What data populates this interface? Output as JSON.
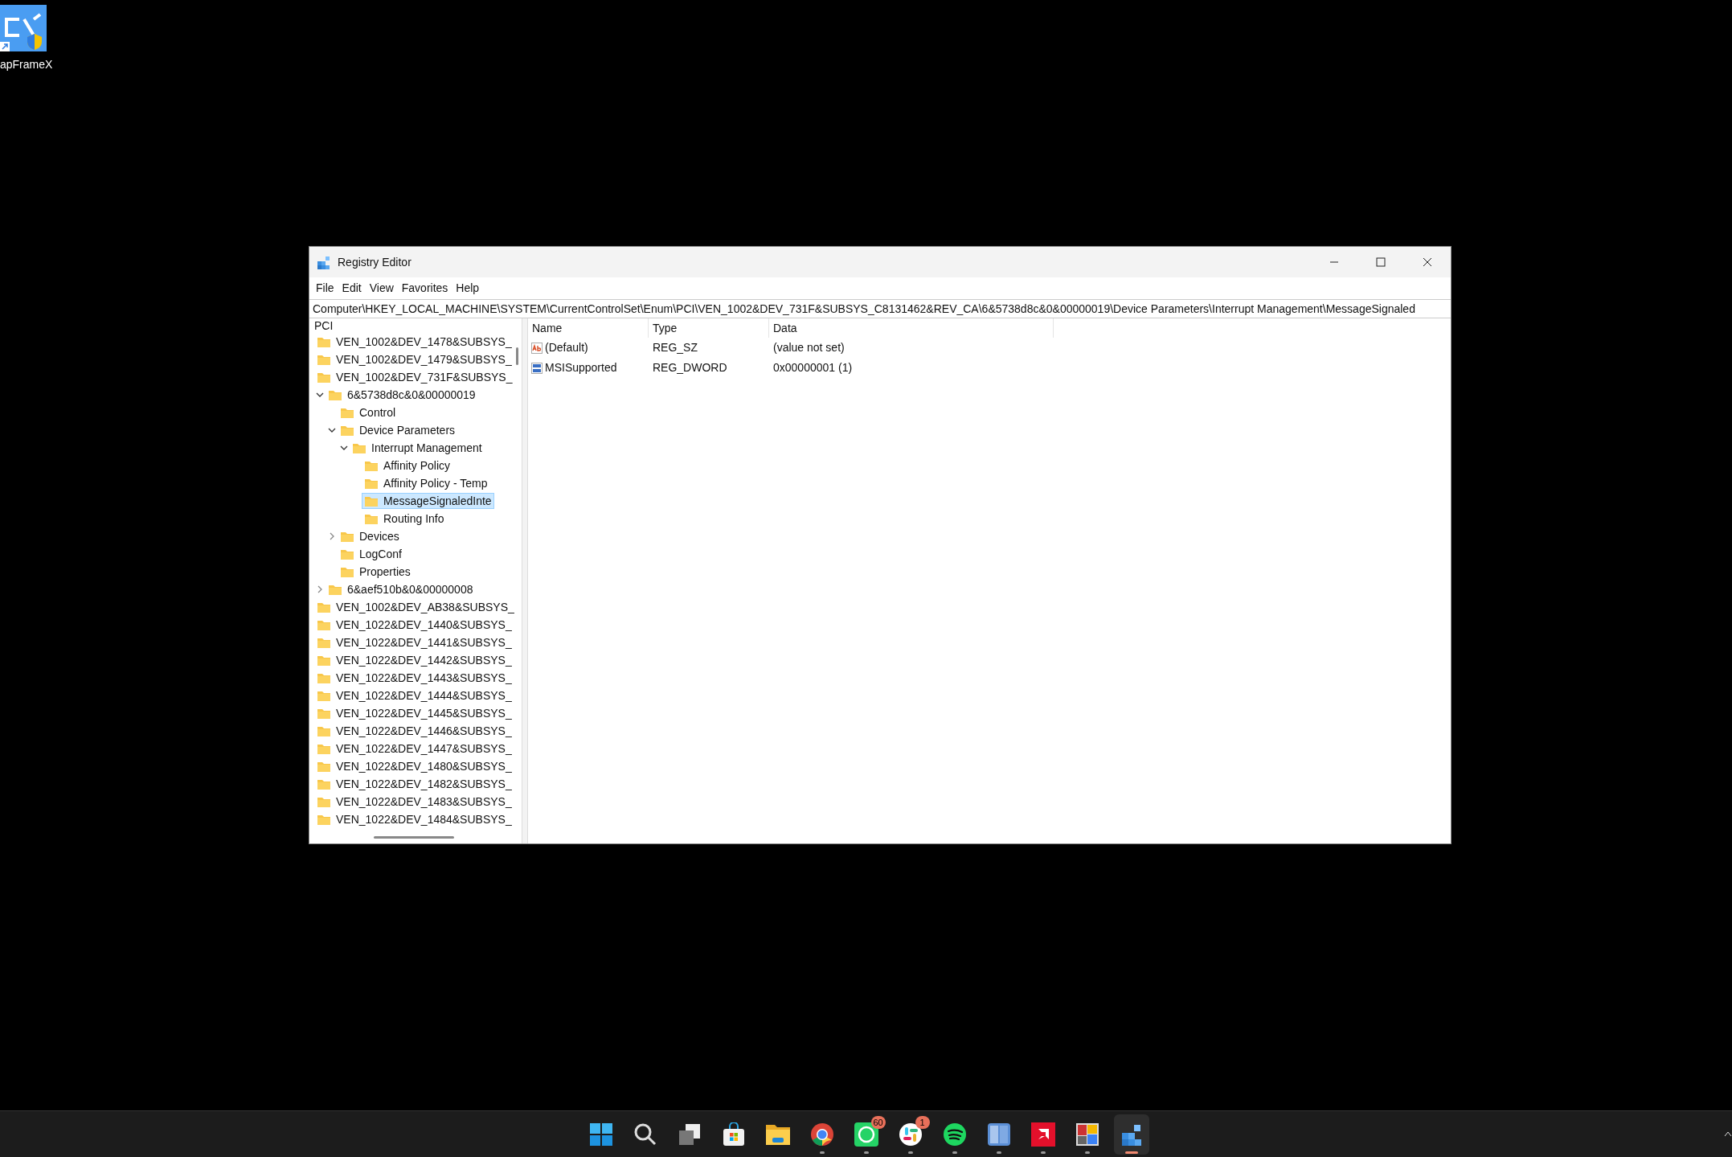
{
  "desktop_icons": [
    {
      "label": "apFrameX"
    }
  ],
  "window": {
    "title": "Registry Editor"
  },
  "menu": [
    "File",
    "Edit",
    "View",
    "Favorites",
    "Help"
  ],
  "address": "Computer\\HKEY_LOCAL_MACHINE\\SYSTEM\\CurrentControlSet\\Enum\\PCI\\VEN_1002&DEV_731F&SUBSYS_C8131462&REV_CA\\6&5738d8c&0&00000019\\Device Parameters\\Interrupt Management\\MessageSignaled",
  "tree": {
    "root": "PCI",
    "items": [
      {
        "label": "VEN_1002&DEV_1478&SUBSYS_",
        "selected": false
      },
      {
        "label": "VEN_1002&DEV_1479&SUBSYS_",
        "selected": false
      },
      {
        "label": "VEN_1002&DEV_731F&SUBSYS_",
        "selected": false,
        "children": [
          {
            "label": "6&5738d8c&0&00000019",
            "selected": false,
            "expanded": true,
            "children": [
              {
                "label": "Control",
                "selected": false
              },
              {
                "label": "Device Parameters",
                "selected": false,
                "expanded": true,
                "children": [
                  {
                    "label": "Interrupt Management",
                    "selected": false,
                    "expanded": true,
                    "children": [
                      {
                        "label": "Affinity Policy",
                        "selected": false
                      },
                      {
                        "label": "Affinity Policy - Temp",
                        "selected": false
                      },
                      {
                        "label": "MessageSignaledInte",
                        "selected": true
                      },
                      {
                        "label": "Routing Info",
                        "selected": false
                      }
                    ]
                  }
                ]
              },
              {
                "label": "Devices",
                "selected": false,
                "expanded": false
              },
              {
                "label": "LogConf",
                "selected": false
              },
              {
                "label": "Properties",
                "selected": false
              }
            ]
          },
          {
            "label": "6&aef510b&0&00000008",
            "selected": false,
            "expanded": false
          }
        ]
      },
      {
        "label": "VEN_1002&DEV_AB38&SUBSYS_",
        "selected": false
      },
      {
        "label": "VEN_1022&DEV_1440&SUBSYS_",
        "selected": false
      },
      {
        "label": "VEN_1022&DEV_1441&SUBSYS_",
        "selected": false
      },
      {
        "label": "VEN_1022&DEV_1442&SUBSYS_",
        "selected": false
      },
      {
        "label": "VEN_1022&DEV_1443&SUBSYS_",
        "selected": false
      },
      {
        "label": "VEN_1022&DEV_1444&SUBSYS_",
        "selected": false
      },
      {
        "label": "VEN_1022&DEV_1445&SUBSYS_",
        "selected": false
      },
      {
        "label": "VEN_1022&DEV_1446&SUBSYS_",
        "selected": false
      },
      {
        "label": "VEN_1022&DEV_1447&SUBSYS_",
        "selected": false
      },
      {
        "label": "VEN_1022&DEV_1480&SUBSYS_",
        "selected": false
      },
      {
        "label": "VEN_1022&DEV_1482&SUBSYS_",
        "selected": false
      },
      {
        "label": "VEN_1022&DEV_1483&SUBSYS_",
        "selected": false
      },
      {
        "label": "VEN_1022&DEV_1484&SUBSYS_",
        "selected": false
      }
    ]
  },
  "values": {
    "columns": [
      "Name",
      "Type",
      "Data"
    ],
    "rows": [
      {
        "kind": "string",
        "name": "(Default)",
        "type": "REG_SZ",
        "data": "(value not set)"
      },
      {
        "kind": "binary",
        "name": "MSISupported",
        "type": "REG_DWORD",
        "data": "0x00000001 (1)"
      }
    ]
  },
  "taskbar": [
    {
      "kind": "start",
      "running": false,
      "active": false
    },
    {
      "kind": "search",
      "running": false,
      "active": false
    },
    {
      "kind": "taskview",
      "running": false,
      "active": false
    },
    {
      "kind": "store",
      "running": false,
      "active": false
    },
    {
      "kind": "folder",
      "running": false,
      "active": false
    },
    {
      "kind": "browser",
      "running": true,
      "active": false
    },
    {
      "kind": "chat",
      "running": true,
      "active": false,
      "badge": "60"
    },
    {
      "kind": "pinwheel",
      "running": true,
      "active": false,
      "badge": "1"
    },
    {
      "kind": "music",
      "running": true,
      "active": false
    },
    {
      "kind": "split",
      "running": true,
      "active": false
    },
    {
      "kind": "redapp",
      "running": true,
      "active": false
    },
    {
      "kind": "tiles",
      "running": true,
      "active": false
    },
    {
      "kind": "cubes",
      "running": true,
      "active": true
    }
  ]
}
